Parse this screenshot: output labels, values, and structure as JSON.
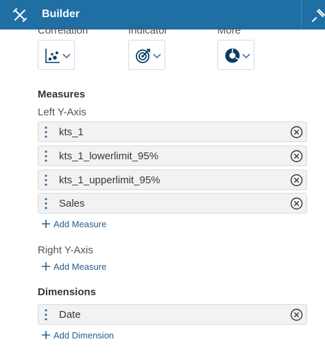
{
  "header": {
    "title": "Builder"
  },
  "chart_types": [
    {
      "label": "Correlation",
      "icon": "scatter-plot-icon"
    },
    {
      "label": "Indicator",
      "icon": "target-gauge-icon"
    },
    {
      "label": "More",
      "icon": "donut-chart-icon"
    }
  ],
  "measures": {
    "title": "Measures",
    "left_axis": {
      "label": "Left Y-Axis",
      "items": [
        "kts_1",
        "kts_1_lowerlimit_95%",
        "kts_1_upperlimit_95%",
        "Sales"
      ],
      "add_label": "Add Measure"
    },
    "right_axis": {
      "label": "Right Y-Axis",
      "add_label": "Add Measure"
    }
  },
  "dimensions": {
    "title": "Dimensions",
    "items": [
      "Date"
    ],
    "add_label": "Add Dimension"
  },
  "colors": {
    "header_bg": "#1f6fa5",
    "accent": "#2a5c8a",
    "token_bg": "#f2f2f2"
  }
}
